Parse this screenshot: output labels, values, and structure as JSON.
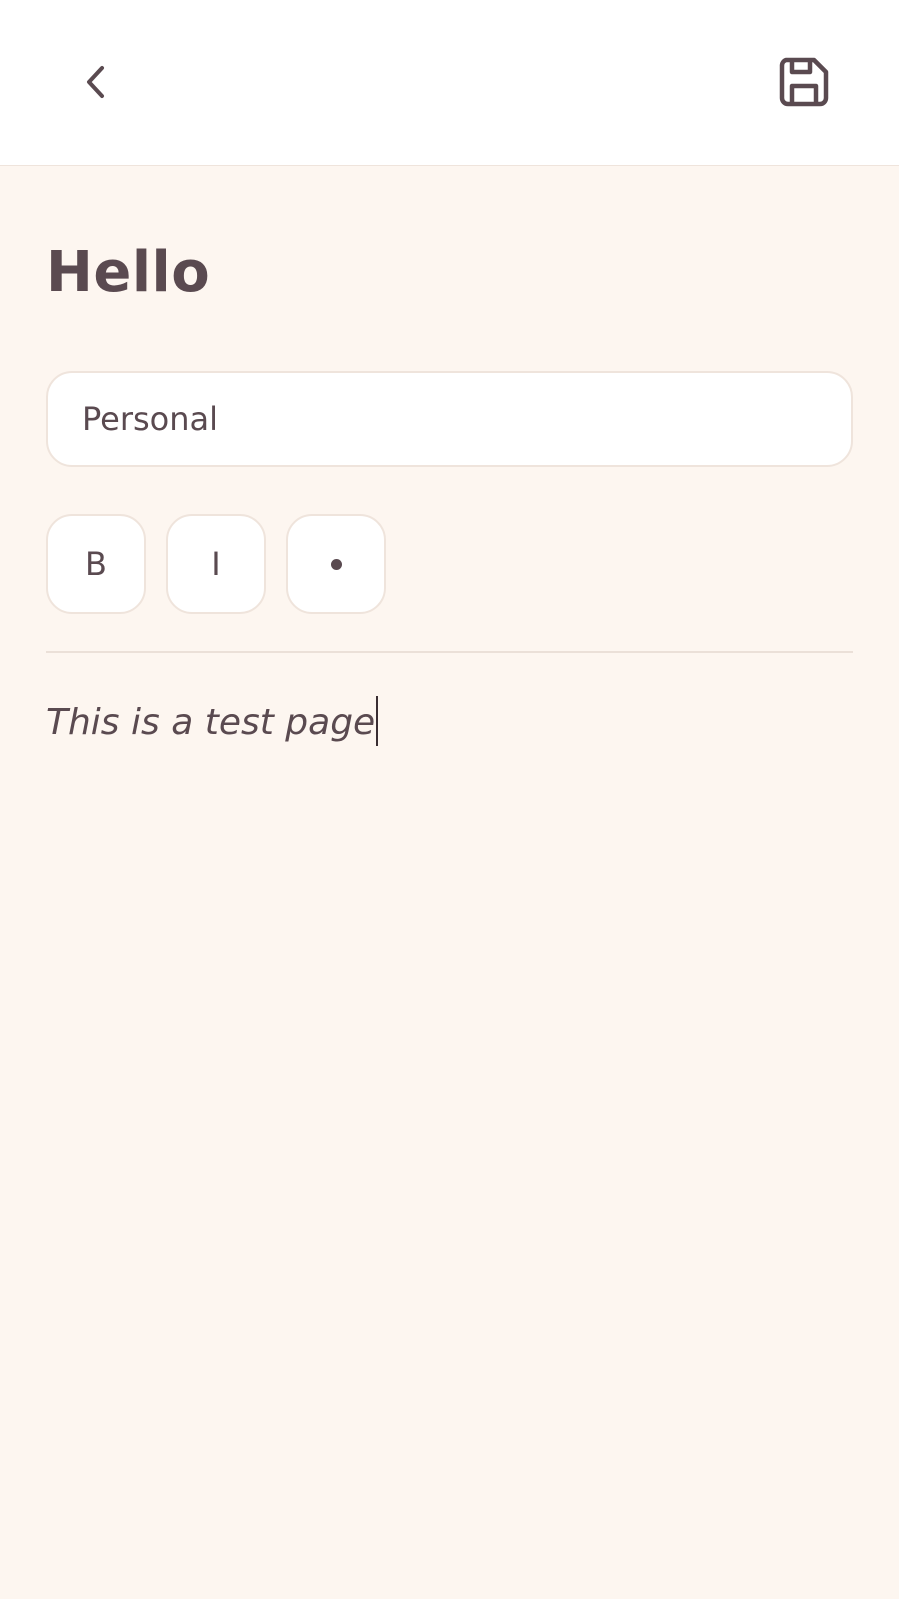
{
  "header": {
    "back_icon": "chevron-left-icon",
    "save_icon": "floppy-disk-icon"
  },
  "note": {
    "title": "Hello",
    "category_value": "Personal",
    "body": "This is a test page"
  },
  "toolbar": {
    "bold_label": "B",
    "italic_label": "I",
    "bullet_icon": "bullet-dot-icon"
  },
  "colors": {
    "background": "#fdf6f0",
    "surface": "#ffffff",
    "text": "#5a4a50",
    "border": "#efe4dc"
  }
}
